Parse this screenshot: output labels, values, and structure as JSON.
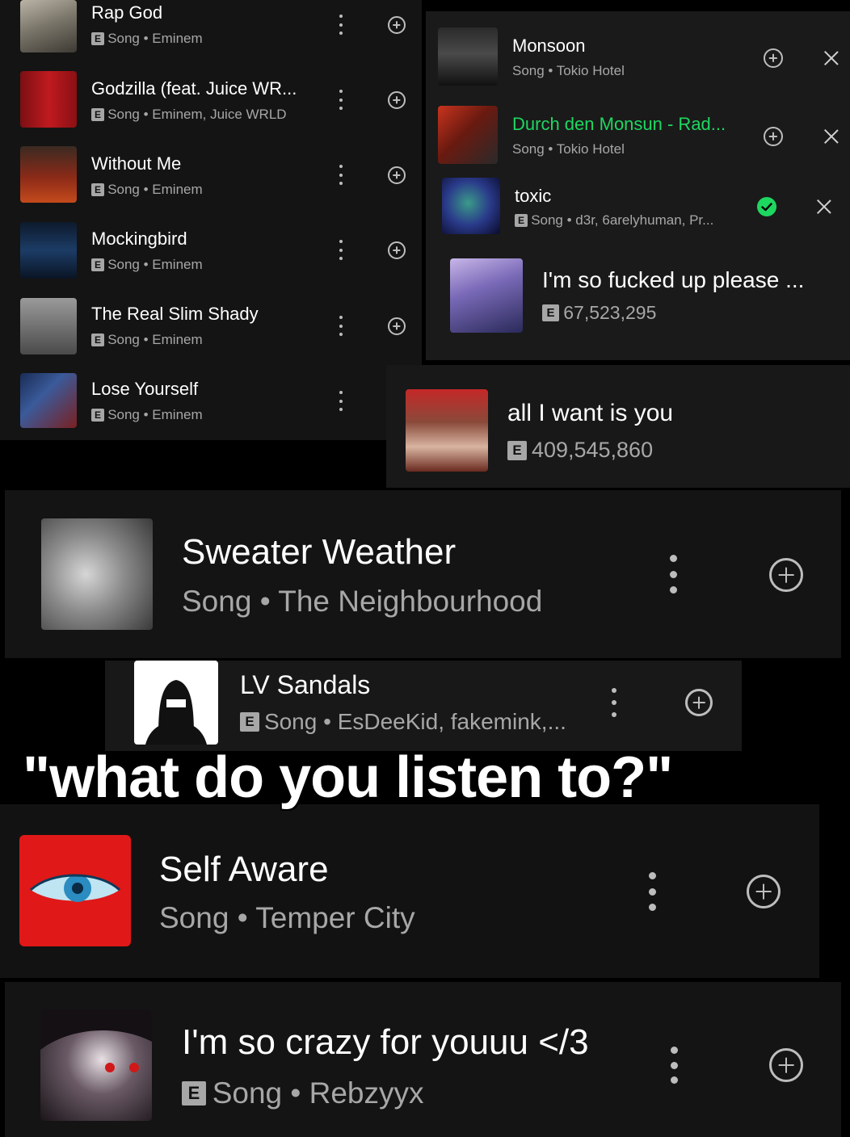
{
  "caption": "\"what do you listen to?\"",
  "colors": {
    "green": "#1ed760",
    "panel": "#121212",
    "subtext": "#a7a7a7"
  },
  "eminem_list": [
    {
      "title": "Rap God",
      "explicit": "E",
      "meta": "Song • Eminem"
    },
    {
      "title": "Godzilla (feat. Juice WR...",
      "explicit": "E",
      "meta": "Song • Eminem, Juice WRLD"
    },
    {
      "title": "Without Me",
      "explicit": "E",
      "meta": "Song • Eminem"
    },
    {
      "title": "Mockingbird",
      "explicit": "E",
      "meta": "Song • Eminem"
    },
    {
      "title": "The Real Slim Shady",
      "explicit": "E",
      "meta": "Song • Eminem"
    },
    {
      "title": "Lose Yourself",
      "explicit": "E",
      "meta": "Song • Eminem"
    }
  ],
  "history_list": [
    {
      "title": "Monsoon",
      "meta": "Song • Tokio Hotel"
    },
    {
      "title": "Durch den Monsun - Rad...",
      "meta": "Song • Tokio Hotel"
    },
    {
      "title": "toxic",
      "explicit": "E",
      "meta": "Song • d3r, 6arelyhuman, Pr..."
    }
  ],
  "im_so_fucked": {
    "title": "I'm so fucked up please ...",
    "explicit": "E",
    "plays": "67,523,295"
  },
  "all_i_want": {
    "title": "all I want is you",
    "explicit": "E",
    "plays": "409,545,860"
  },
  "sweater_weather": {
    "title": "Sweater Weather",
    "meta": "Song • The Neighbourhood"
  },
  "lv_sandals": {
    "title": "LV Sandals",
    "explicit": "E",
    "meta": "Song • EsDeeKid, fakemink,..."
  },
  "self_aware": {
    "title": "Self Aware",
    "meta": "Song • Temper City"
  },
  "crazy_for_you": {
    "title": "I'm so crazy for youuu </3",
    "explicit": "E",
    "meta": "Song • Rebzyyx"
  }
}
